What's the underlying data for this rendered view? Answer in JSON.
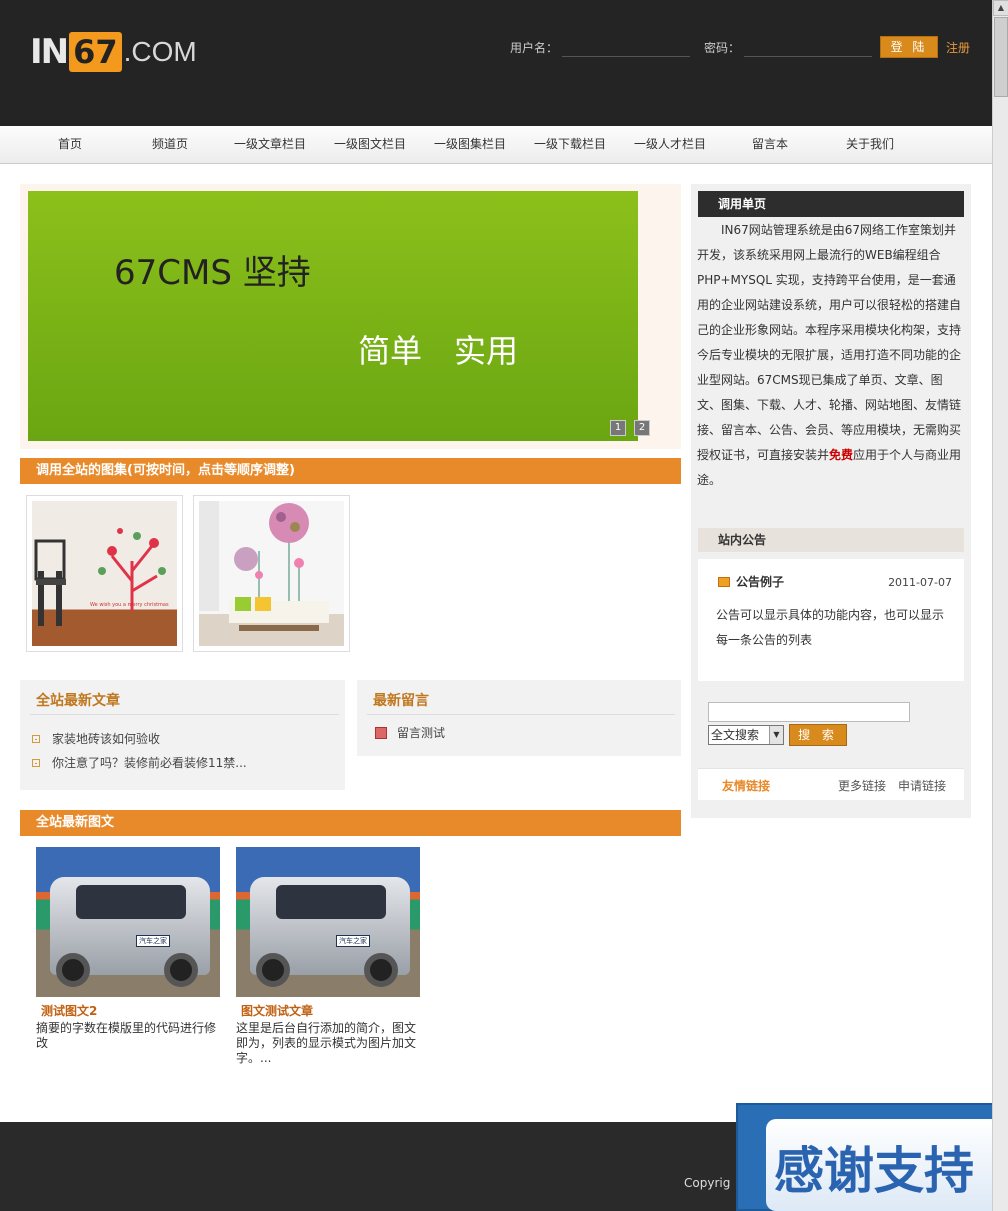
{
  "header": {
    "logo": {
      "in": "IN",
      "num": "67",
      "com": ".COM"
    },
    "username_label": "用户名：",
    "password_label": "密码：",
    "login_button": "登 陆",
    "register_link": "注册"
  },
  "nav": {
    "items": [
      {
        "label": "首页"
      },
      {
        "label": "频道页"
      },
      {
        "label": "一级文章栏目"
      },
      {
        "label": "一级图文栏目"
      },
      {
        "label": "一级图集栏目"
      },
      {
        "label": "一级下载栏目"
      },
      {
        "label": "一级人才栏目"
      },
      {
        "label": "留言本"
      },
      {
        "label": "关于我们"
      }
    ]
  },
  "banner": {
    "line1": "67CMS 坚持",
    "line2": "简单　实用",
    "pages": [
      "1",
      "2"
    ]
  },
  "gallery": {
    "title": "调用全站的图集(可按时间，点击等顺序调整)",
    "caption": "We wish you a merry christmas"
  },
  "latest_articles": {
    "title": "全站最新文章",
    "items": [
      "家装地砖该如何验收",
      "你注意了吗？装修前必看装修11禁..."
    ]
  },
  "latest_messages": {
    "title": "最新留言",
    "items": [
      "留言测试"
    ]
  },
  "photo_news": {
    "title": "全站最新图文",
    "items": [
      {
        "title": "测试图文2",
        "desc": "摘要的字数在模版里的代码进行修改",
        "badge": "汽车之家"
      },
      {
        "title": "图文测试文章",
        "desc": "这里是后台自行添加的简介，图文即为，列表的显示模式为图片加文字。...",
        "badge": "汽车之家"
      }
    ]
  },
  "sidebar": {
    "single_page_title": "调用单页",
    "single_page_text_a": "IN67网站管理系统是由67网络工作室策划并开发，该系统采用网上最流行的WEB编程组合 PHP+MYSQL 实现，支持跨平台使用，是一套通用的企业网站建设系统，用户可以很轻松的搭建自己的企业形象网站。本程序采用模块化构架，支持今后专业模块的无限扩展，适用打造不同功能的企业型网站。67CMS现已集成了单页、文章、图文、图集、下载、人才、轮播、网站地图、友情链接、留言本、公告、会员、等应用模块，无需购买授权证书，可直接安装并",
    "single_page_text_free": "免费",
    "single_page_text_b": "应用于个人与商业用途。",
    "notice_title": "站内公告",
    "notice": {
      "title": "公告例子",
      "date": "2011-07-07",
      "body": "公告可以显示具体的功能内容，也可以显示每一条公告的列表"
    },
    "search": {
      "select_value": "全文搜索",
      "button": "搜 索"
    },
    "links": {
      "title": "友情链接",
      "more": "更多链接",
      "apply": "申请链接"
    }
  },
  "footer": {
    "copyright": "Copyrig"
  },
  "ad": {
    "text": "感谢支持"
  }
}
